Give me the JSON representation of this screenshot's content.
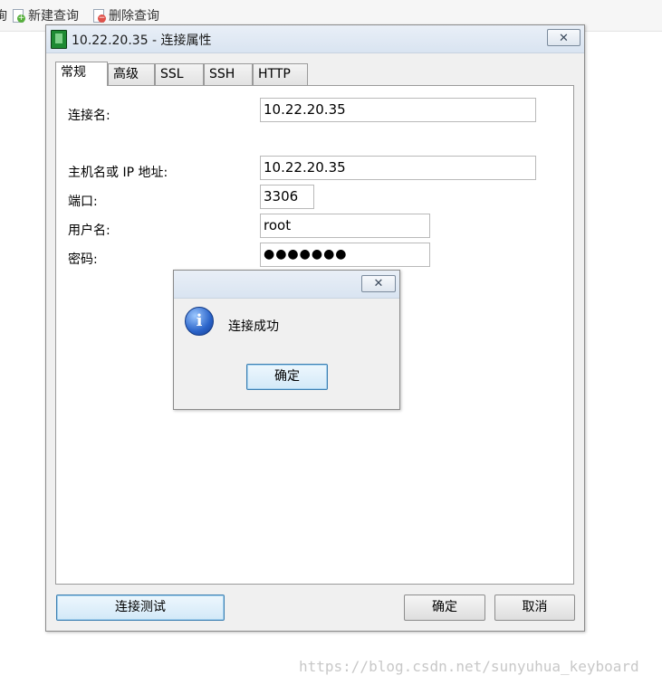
{
  "toolbar": {
    "partial_left": "询",
    "new_query_label": "新建查询",
    "delete_query_label": "删除查询"
  },
  "dialog": {
    "title": "10.22.20.35 - 连接属性",
    "close_symbol": "✕",
    "tabs": [
      {
        "label": "常规",
        "active": true
      },
      {
        "label": "高级",
        "active": false
      },
      {
        "label": "SSL",
        "active": false
      },
      {
        "label": "SSH",
        "active": false
      },
      {
        "label": "HTTP",
        "active": false
      }
    ],
    "form": {
      "connection_name_label": "连接名:",
      "connection_name_value": "10.22.20.35",
      "host_label": "主机名或 IP 地址:",
      "host_value": "10.22.20.35",
      "port_label": "端口:",
      "port_value": "3306",
      "username_label": "用户名:",
      "username_value": "root",
      "password_label": "密码:",
      "password_value": "●●●●●●●"
    },
    "buttons": {
      "test_connection": "连接测试",
      "ok": "确定",
      "cancel": "取消"
    }
  },
  "message_box": {
    "close_symbol": "✕",
    "icon_glyph": "i",
    "message": "连接成功",
    "ok_label": "确定"
  },
  "watermark": "https://blog.csdn.net/sunyuhua_keyboard"
}
